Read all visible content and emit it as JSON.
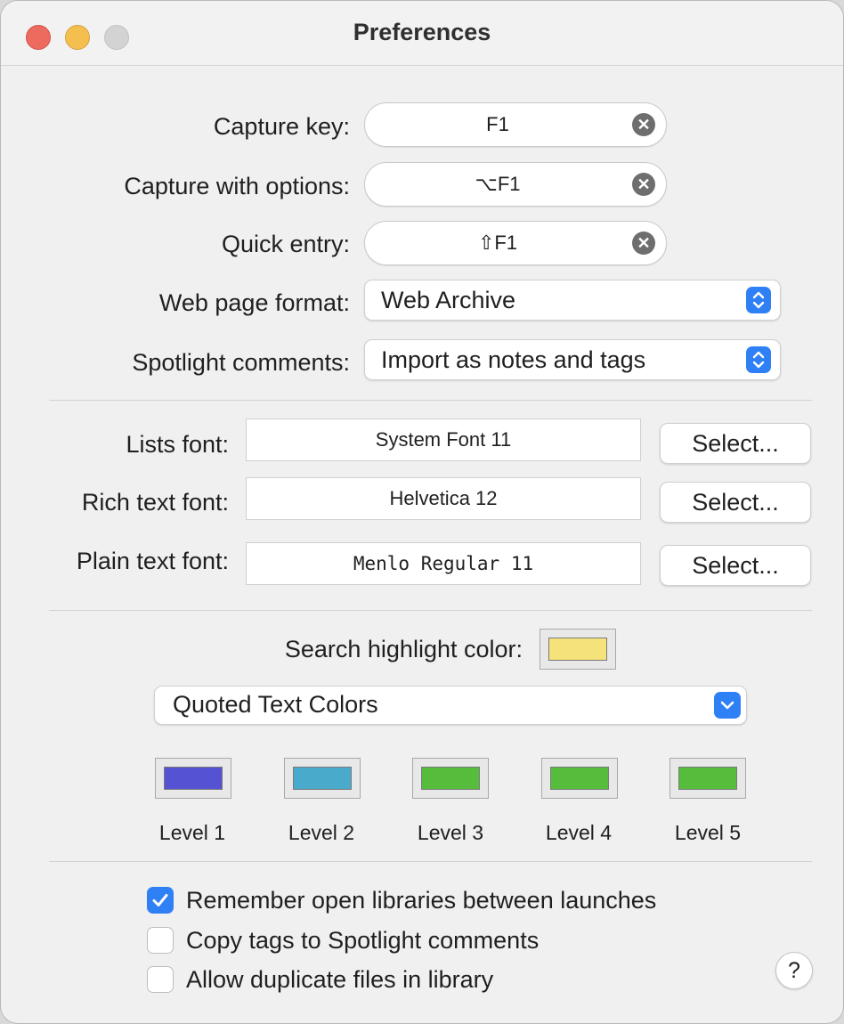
{
  "window": {
    "title": "Preferences"
  },
  "shortcuts": [
    {
      "label": "Capture key:",
      "value": "F1"
    },
    {
      "label": "Capture with options:",
      "value": "⌥F1"
    },
    {
      "label": "Quick entry:",
      "value": "⇧F1"
    }
  ],
  "popups": {
    "web_page_format": {
      "label": "Web page format:",
      "value": "Web Archive"
    },
    "spotlight_comments": {
      "label": "Spotlight comments:",
      "value": "Import as notes and tags"
    }
  },
  "fonts": {
    "select_label": "Select...",
    "lists": {
      "label": "Lists font:",
      "value": "System Font 11"
    },
    "rich": {
      "label": "Rich text font:",
      "value": "Helvetica 12"
    },
    "plain": {
      "label": "Plain text font:",
      "value": "Menlo Regular 11"
    }
  },
  "search_highlight": {
    "label": "Search highlight color:",
    "color": "#f6e27a"
  },
  "quoted_text": {
    "popup_value": "Quoted Text Colors",
    "levels": [
      {
        "label": "Level 1",
        "color": "#5652d4"
      },
      {
        "label": "Level 2",
        "color": "#4aaacb"
      },
      {
        "label": "Level 3",
        "color": "#56bd3c"
      },
      {
        "label": "Level 4",
        "color": "#56bd3c"
      },
      {
        "label": "Level 5",
        "color": "#56bd3c"
      }
    ]
  },
  "options": [
    {
      "label": "Remember open libraries between launches",
      "checked": true
    },
    {
      "label": "Copy tags to Spotlight comments",
      "checked": false
    },
    {
      "label": "Allow duplicate files in library",
      "checked": false
    }
  ],
  "help_label": "?",
  "icons": {
    "clear": "clear-x-icon",
    "stepper": "up-down-chevron-icon",
    "dropdown": "chevron-down-icon",
    "check": "checkmark-icon"
  }
}
